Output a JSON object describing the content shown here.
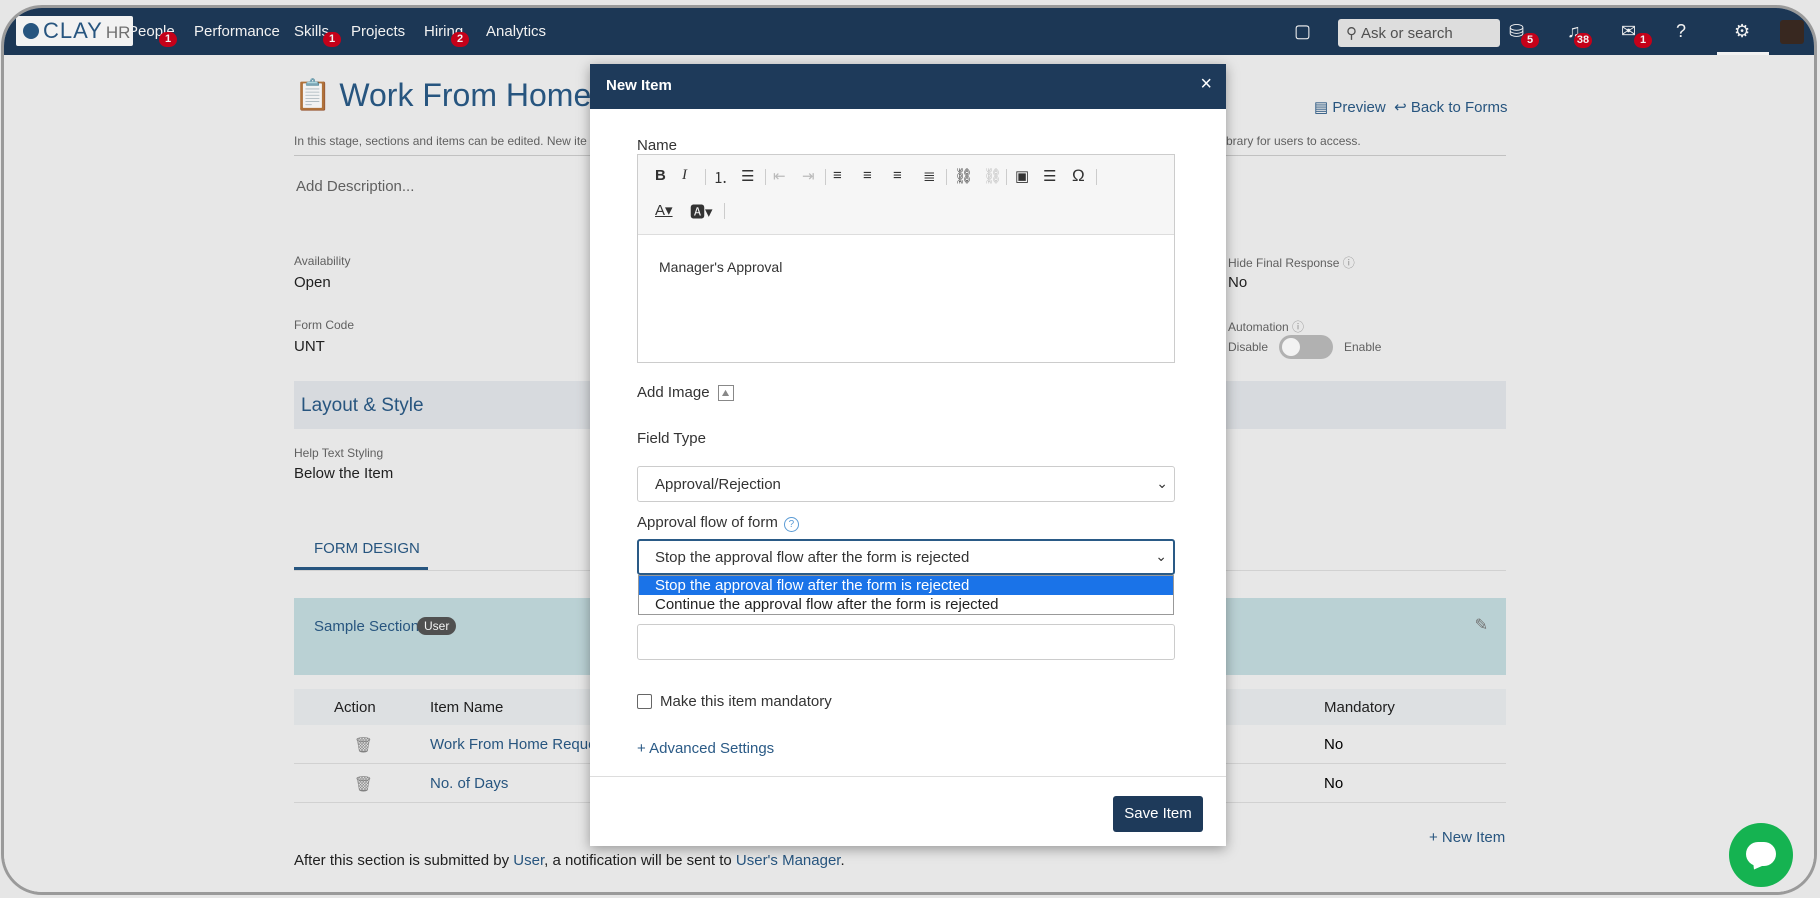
{
  "app": {
    "logo_main": "CLAY",
    "logo_sub": "HR"
  },
  "nav": {
    "items": [
      {
        "label": "People",
        "badge": "1"
      },
      {
        "label": "Performance",
        "badge": ""
      },
      {
        "label": "Skills",
        "badge": "1"
      },
      {
        "label": "Projects",
        "badge": ""
      },
      {
        "label": "Hiring",
        "badge": "2"
      },
      {
        "label": "Analytics",
        "badge": ""
      }
    ],
    "search_placeholder": "Ask or search",
    "icon_badges": {
      "learning": "5",
      "notifications": "38",
      "messages": "1"
    }
  },
  "page": {
    "title": "Work From Home",
    "preview_link": "Preview",
    "back_link": "Back to Forms",
    "subtitle_left": "In this stage, sections and items can be edited. New ite",
    "subtitle_right": "brary for users to access.",
    "add_description": "Add Description...",
    "availability_label": "Availability",
    "availability_value": "Open",
    "form_code_label": "Form Code",
    "form_code_value": "UNT",
    "hide_final_label": "Hide Final Response",
    "hide_final_value": "No",
    "automation_label": "Automation",
    "automation_off": "Disable",
    "automation_on": "Enable",
    "layout_style": "Layout & Style",
    "help_text_label": "Help Text Styling",
    "help_text_value": "Below the Item",
    "form_design_tab": "FORM DESIGN",
    "section_title": "Sample Section",
    "section_badge": "User",
    "table": {
      "headers": {
        "action": "Action",
        "item_name": "Item Name",
        "mandatory": "Mandatory"
      },
      "rows": [
        {
          "item_name": "Work From Home Reque",
          "mandatory": "No"
        },
        {
          "item_name": "No. of Days",
          "mandatory": "No"
        }
      ]
    },
    "new_item_link": "+ New Item",
    "footer": {
      "pre": "After this section is submitted by ",
      "user": "User",
      "mid": ", a notification will be sent to ",
      "manager": "User's Manager",
      "post": "."
    }
  },
  "modal": {
    "title": "New Item",
    "name_label": "Name",
    "editor_text": "Manager's Approval",
    "add_image_label": "Add Image",
    "field_type_label": "Field Type",
    "field_type_value": "Approval/Rejection",
    "approval_flow_label": "Approval flow of form",
    "approval_flow_value": "Stop the approval flow after the form is rejected",
    "approval_flow_options": [
      "Stop the approval flow after the form is rejected",
      "Continue the approval flow after the form is rejected"
    ],
    "mandatory_label": "Make this item mandatory",
    "advanced_settings": "+ Advanced Settings",
    "save_button": "Save Item"
  },
  "colors": {
    "primary": "#1e3a5a",
    "link": "#2a5a86",
    "badge": "#d0021b",
    "selected_option": "#1a73e8",
    "chat": "#15b351"
  }
}
